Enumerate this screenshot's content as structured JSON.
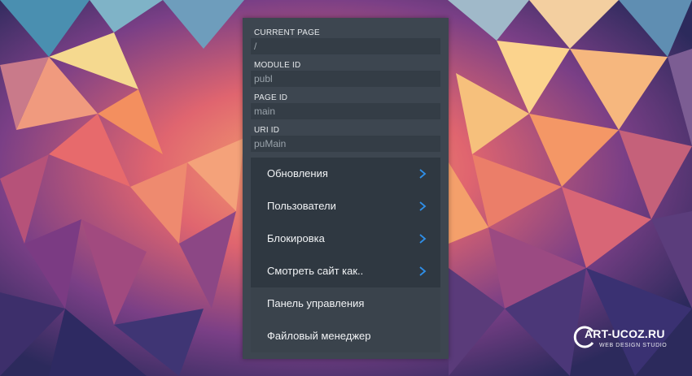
{
  "fields": [
    {
      "label": "CURRENT PAGE",
      "value": "/"
    },
    {
      "label": "MODULE ID",
      "value": "publ"
    },
    {
      "label": "PAGE ID",
      "value": "main"
    },
    {
      "label": "URI ID",
      "value": "puMain"
    }
  ],
  "menu": [
    {
      "label": "Обновления",
      "submenu": true
    },
    {
      "label": "Пользователи",
      "submenu": true
    },
    {
      "label": "Блокировка",
      "submenu": true
    },
    {
      "label": "Смотреть сайт как..",
      "submenu": true
    },
    {
      "label": "Панель управления",
      "submenu": false
    },
    {
      "label": "Файловый менеджер",
      "submenu": false
    }
  ],
  "watermark": {
    "name": "ART-UCOZ.RU",
    "tagline": "WEB DESIGN STUDIO"
  },
  "colors": {
    "accent_chevron": "#2f8fe8",
    "panel_bg": "#3d4650",
    "menu_bg": "#2f3841"
  }
}
